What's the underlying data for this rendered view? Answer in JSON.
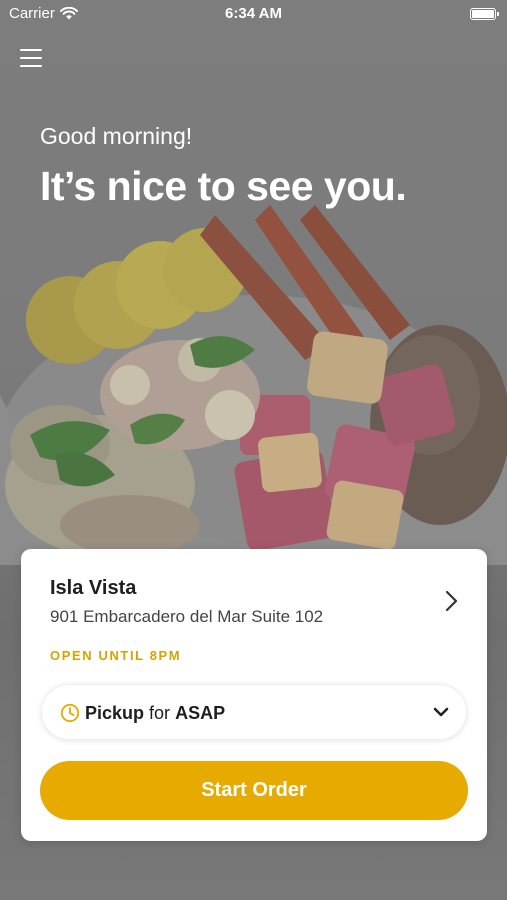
{
  "status_bar": {
    "carrier": "Carrier",
    "time": "6:34 AM",
    "battery_level": 1.0
  },
  "header": {
    "menu_icon": "hamburger-menu-icon",
    "greeting": "Good morning!",
    "headline": "It’s nice to see you."
  },
  "location": {
    "name": "Isla Vista",
    "address": "901 Embarcadero del Mar Suite 102",
    "hours": "OPEN UNTIL 8PM"
  },
  "order_mode": {
    "mode": "Pickup",
    "connector": "for",
    "time": "ASAP",
    "icon": "clock-icon",
    "dropdown_icon": "chevron-down-icon"
  },
  "start_order_label": "Start Order",
  "colors": {
    "accent": "#e6aa00",
    "hours_text": "#d8a300",
    "overlay": "#7a7a7a"
  }
}
